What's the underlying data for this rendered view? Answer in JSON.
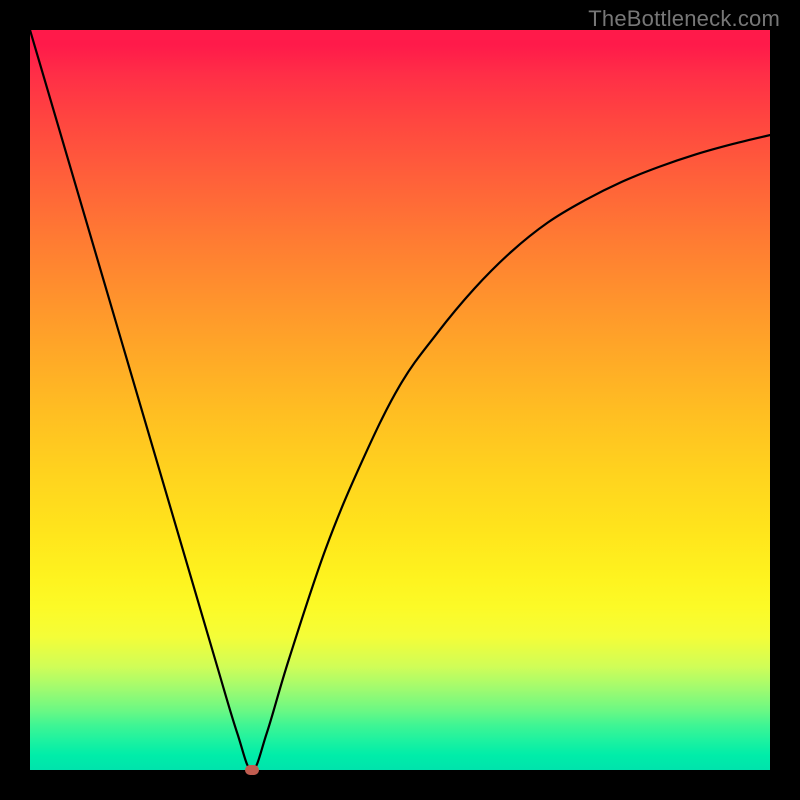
{
  "watermark": "TheBottleneck.com",
  "chart_data": {
    "type": "line",
    "title": "",
    "xlabel": "",
    "ylabel": "",
    "xlim": [
      0,
      100
    ],
    "ylim": [
      0,
      100
    ],
    "grid": false,
    "series": [
      {
        "name": "curve",
        "x": [
          0,
          5,
          10,
          15,
          20,
          25,
          28,
          30,
          32,
          35,
          40,
          45,
          50,
          55,
          60,
          65,
          70,
          75,
          80,
          85,
          90,
          95,
          100
        ],
        "values": [
          100,
          83,
          66,
          49,
          32,
          15,
          5,
          0,
          5,
          15,
          30,
          42,
          52,
          59,
          65,
          70,
          74,
          77,
          79.5,
          81.5,
          83.2,
          84.6,
          85.8
        ]
      }
    ],
    "marker": {
      "x": 30,
      "y": 0
    },
    "background_gradient": {
      "top": "#ff1a4a",
      "mid": "#ffe51c",
      "bottom": "#00e3ac"
    },
    "curve_color": "#000000",
    "marker_color": "#c15d50"
  }
}
